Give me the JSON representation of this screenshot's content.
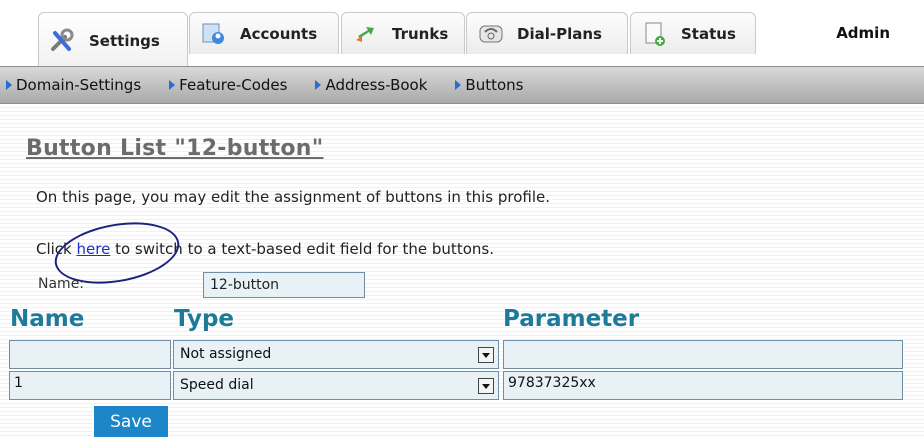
{
  "tabs": [
    {
      "label": "Settings",
      "icon": "settings-tools-icon",
      "active": true
    },
    {
      "label": "Accounts",
      "icon": "accounts-icon"
    },
    {
      "label": "Trunks",
      "icon": "trunks-arrows-icon"
    },
    {
      "label": "Dial-Plans",
      "icon": "telephone-icon"
    },
    {
      "label": "Status",
      "icon": "status-document-icon"
    }
  ],
  "user": "Admin",
  "subnav": [
    "Domain-Settings",
    "Feature-Codes",
    "Address-Book",
    "Buttons"
  ],
  "page": {
    "title": "Button List \"12-button\"",
    "intro": "On this page, you may edit the assignment of buttons in this profile.",
    "click_prefix": "Click ",
    "click_link": "here",
    "click_suffix": " to switch to a text-based edit field for the buttons.",
    "name_label": "Name:",
    "name_value": "12-button"
  },
  "table": {
    "headers": [
      "Name",
      "Type",
      "Parameter"
    ],
    "rows": [
      {
        "name": "",
        "type": "Not assigned",
        "parameter": ""
      },
      {
        "name": "1",
        "type": "Speed dial",
        "parameter": "97837325xx"
      }
    ]
  },
  "save_label": "Save",
  "colors": {
    "accent": "#1f7a9a",
    "button": "#1d86c8",
    "annotation": "#1a237e"
  }
}
